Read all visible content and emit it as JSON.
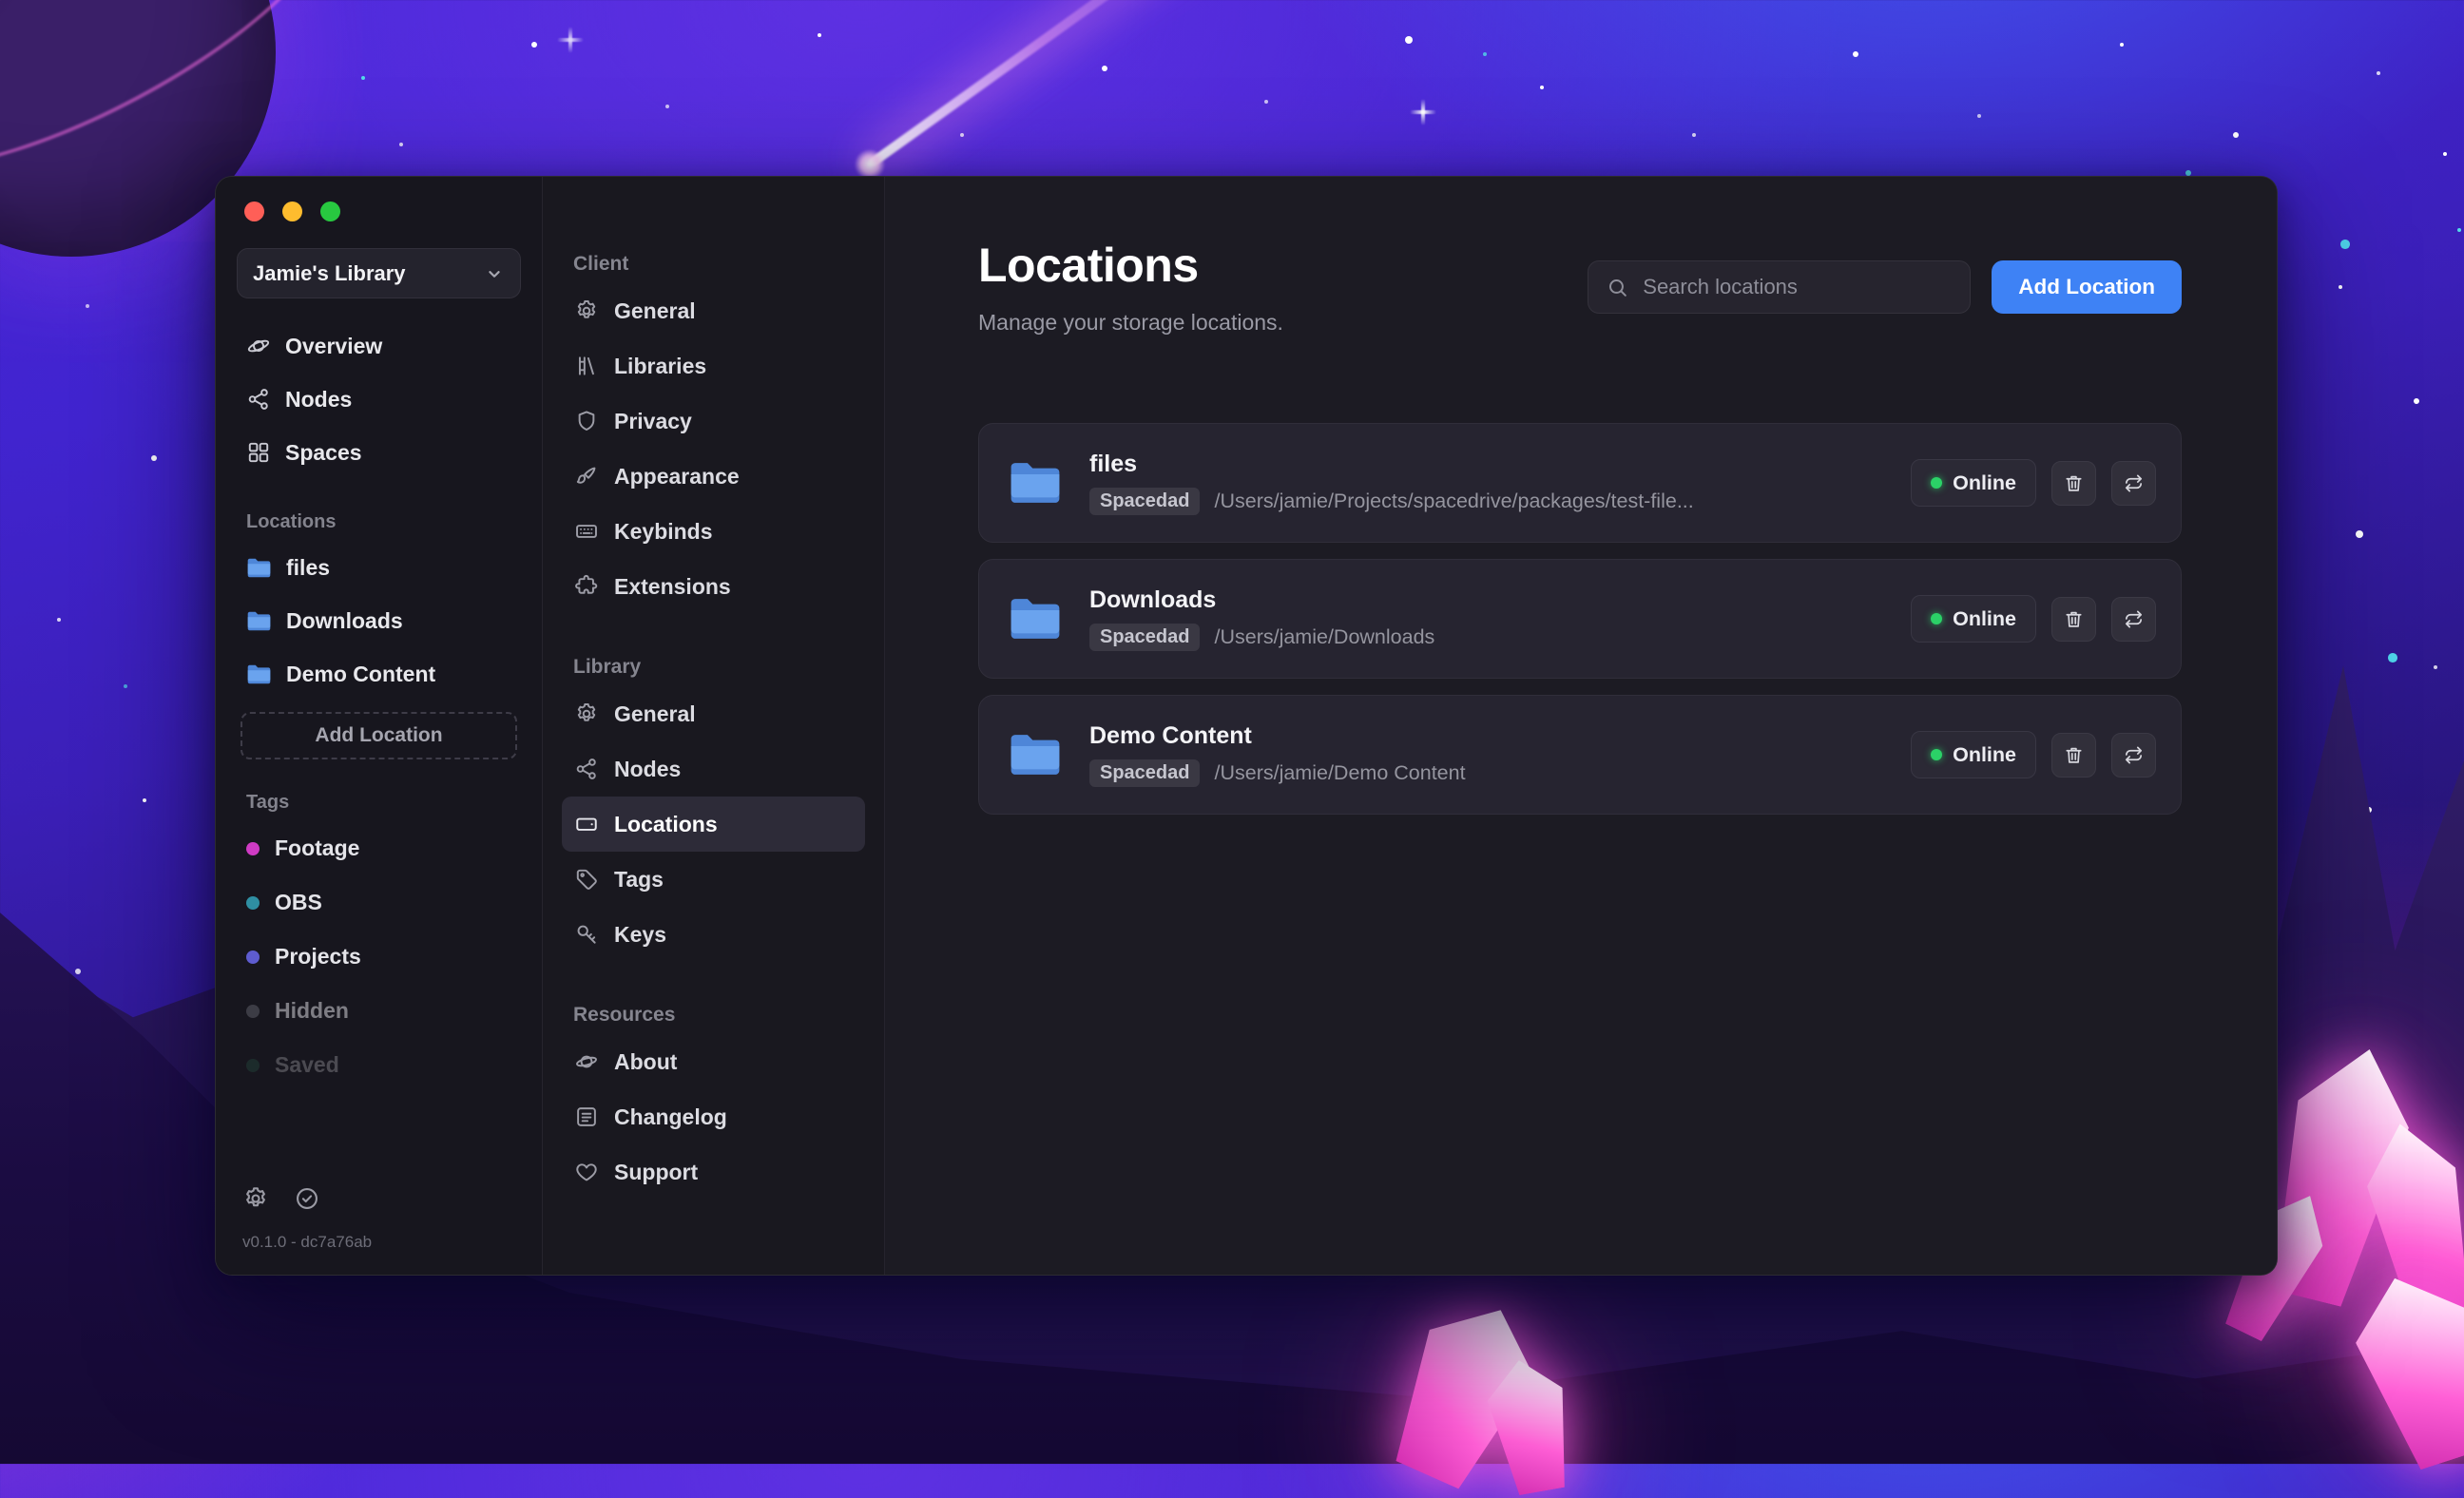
{
  "sidebar": {
    "library_name": "Jamie's Library",
    "nav": [
      {
        "label": "Overview"
      },
      {
        "label": "Nodes"
      },
      {
        "label": "Spaces"
      }
    ],
    "locations_header": "Locations",
    "locations": [
      {
        "label": "files"
      },
      {
        "label": "Downloads"
      },
      {
        "label": "Demo Content"
      }
    ],
    "add_location_label": "Add Location",
    "tags_header": "Tags",
    "tags": [
      {
        "label": "Footage",
        "color": "#cf3bc4"
      },
      {
        "label": "OBS",
        "color": "#2f8fa3"
      },
      {
        "label": "Projects",
        "color": "#5e5cd0"
      },
      {
        "label": "Hidden",
        "color": "#62626c"
      },
      {
        "label": "Saved",
        "color": "#2e6b55"
      }
    ],
    "version": "v0.1.0 - dc7a76ab"
  },
  "settings_nav": {
    "sections": [
      {
        "header": "Client",
        "items": [
          {
            "label": "General"
          },
          {
            "label": "Libraries"
          },
          {
            "label": "Privacy"
          },
          {
            "label": "Appearance"
          },
          {
            "label": "Keybinds"
          },
          {
            "label": "Extensions"
          }
        ]
      },
      {
        "header": "Library",
        "items": [
          {
            "label": "General"
          },
          {
            "label": "Nodes"
          },
          {
            "label": "Locations"
          },
          {
            "label": "Tags"
          },
          {
            "label": "Keys"
          }
        ]
      },
      {
        "header": "Resources",
        "items": [
          {
            "label": "About"
          },
          {
            "label": "Changelog"
          },
          {
            "label": "Support"
          }
        ]
      }
    ],
    "selected": "Locations"
  },
  "main": {
    "title": "Locations",
    "subtitle": "Manage your storage locations.",
    "search": {
      "placeholder": "Search locations"
    },
    "add_location_button": "Add Location",
    "locations": [
      {
        "name": "files",
        "node": "Spacedad",
        "path": "/Users/jamie/Projects/spacedrive/packages/test-file...",
        "status": "Online"
      },
      {
        "name": "Downloads",
        "node": "Spacedad",
        "path": "/Users/jamie/Downloads",
        "status": "Online"
      },
      {
        "name": "Demo Content",
        "node": "Spacedad",
        "path": "/Users/jamie/Demo Content",
        "status": "Online"
      }
    ]
  },
  "colors": {
    "accent_blue": "#3e82f5",
    "online_green": "#2bd167",
    "folder_blue": "#5b97e8"
  }
}
